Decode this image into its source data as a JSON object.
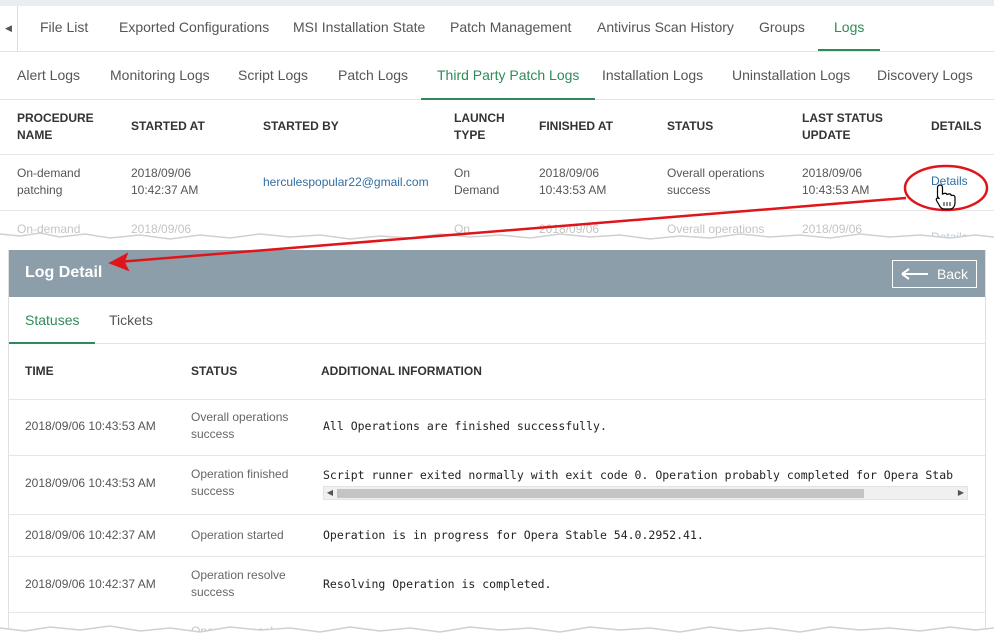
{
  "main_tabs": [
    "File List",
    "Exported Configurations",
    "MSI Installation State",
    "Patch Management",
    "Antivirus Scan History",
    "Groups",
    "Logs"
  ],
  "sub_tabs": [
    "Alert Logs",
    "Monitoring Logs",
    "Script Logs",
    "Patch Logs",
    "Third Party Patch Logs",
    "Installation Logs",
    "Uninstallation Logs",
    "Discovery Logs"
  ],
  "table": {
    "headers": {
      "procedure_name": [
        "PROCEDURE",
        "NAME"
      ],
      "started_at": "STARTED AT",
      "started_by": "STARTED BY",
      "launch_type": [
        "LAUNCH",
        "TYPE"
      ],
      "finished_at": "FINISHED AT",
      "status": "STATUS",
      "last_status_update": [
        "LAST STATUS",
        "UPDATE"
      ],
      "details": "DETAILS"
    },
    "rows": [
      {
        "procedure_name": [
          "On-demand",
          "patching"
        ],
        "started_at": [
          "2018/09/06",
          "10:42:37 AM"
        ],
        "started_by": "herculespopular22@gmail.com",
        "launch_type": [
          "On",
          "Demand"
        ],
        "finished_at": [
          "2018/09/06",
          "10:43:53 AM"
        ],
        "status": [
          "Overall operations",
          "success"
        ],
        "last_status_update": [
          "2018/09/06",
          "10:43:53 AM"
        ],
        "details": "Details"
      },
      {
        "procedure_name": "On-demand",
        "started_at": "2018/09/06",
        "launch_type": "On",
        "finished_at": "2018/09/06",
        "status": "Overall operations",
        "last_status_update": "2018/09/06",
        "details": "Details"
      }
    ]
  },
  "log_detail": {
    "title": "Log Detail",
    "back_label": "Back",
    "tabs": [
      "Statuses",
      "Tickets"
    ],
    "headers": {
      "time": "TIME",
      "status": "STATUS",
      "additional_info": "ADDITIONAL INFORMATION"
    },
    "rows": [
      {
        "time": "2018/09/06 10:43:53 AM",
        "status": [
          "Overall operations",
          "success"
        ],
        "info": "All Operations are finished successfully."
      },
      {
        "time": "2018/09/06 10:43:53 AM",
        "status": [
          "Operation finished",
          "success"
        ],
        "info": "Script runner exited normally with exit code 0. Operation probably completed for Opera Stab"
      },
      {
        "time": "2018/09/06 10:42:37 AM",
        "status": [
          "Operation started"
        ],
        "info": "Operation is in progress for Opera Stable 54.0.2952.41."
      },
      {
        "time": "2018/09/06 10:42:37 AM",
        "status": [
          "Operation resolve",
          "success"
        ],
        "info": "Resolving Operation is completed."
      },
      {
        "status_partial": "Operation resolve"
      }
    ]
  },
  "colors": {
    "accent_green": "#2e8b57",
    "link_blue": "#2f6ea4",
    "header_gray": "#8b9ea9",
    "annotation_red": "#e0151b"
  },
  "icons": {
    "scroll_left": "triangle-left-icon",
    "back_arrow": "arrow-left-icon",
    "hand_cursor": "hand-pointer-icon"
  }
}
